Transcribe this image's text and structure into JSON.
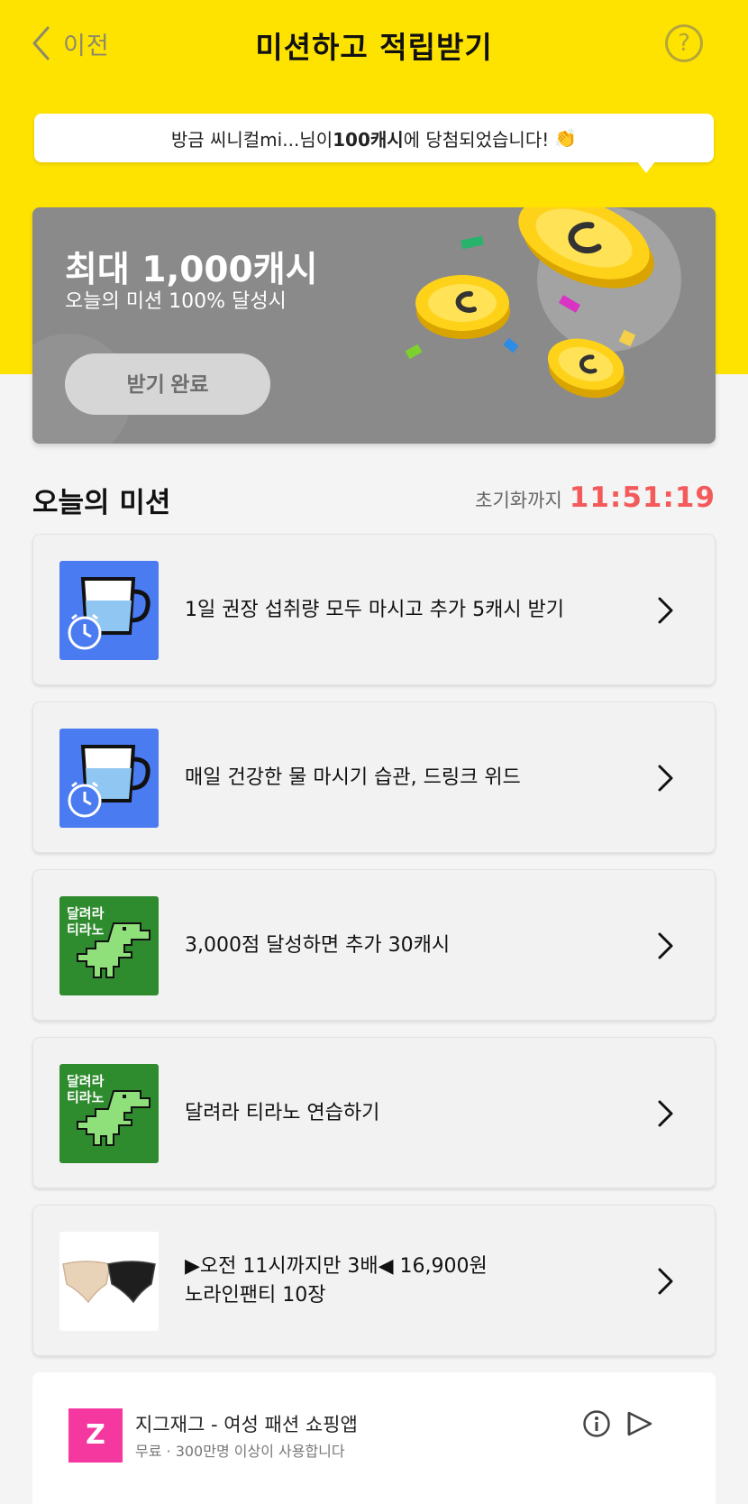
{
  "header": {
    "back_label": "이전",
    "title": "미션하고 적립받기",
    "help_label": "?"
  },
  "notice": {
    "prefix": "방금 씨니컬mi...님이 ",
    "amount": "100캐시",
    "suffix": "에 당첨되었습니다!",
    "emoji": "👏"
  },
  "banner": {
    "title": "최대 1,000캐시",
    "subtitle": "오늘의 미션 100% 달성시",
    "button_label": "받기 완료"
  },
  "missions": {
    "title": "오늘의 미션",
    "reset_label": "초기화까지",
    "reset_time": "11:51:19",
    "items": [
      {
        "line1": "1일 권장 섭취량 모두 마시고 추가 5캐시 받기",
        "line2": "",
        "thumb": "water-cup-icon"
      },
      {
        "line1": "매일 건강한 물 마시기 습관, 드링크 위드",
        "line2": "",
        "thumb": "water-cup-icon"
      },
      {
        "line1": "3,000점 달성하면 추가 30캐시",
        "line2": "",
        "thumb": "dino-game-icon",
        "thumb_text1": "달려라",
        "thumb_text2": "티라노"
      },
      {
        "line1": "달려라 티라노 연습하기",
        "line2": "",
        "thumb": "dino-game-icon",
        "thumb_text1": "달려라",
        "thumb_text2": "티라노"
      },
      {
        "line1": "▶오전 11시까지만 3배◀ 16,900원",
        "line2": "노라인팬티 10장",
        "thumb": "product-image"
      }
    ]
  },
  "ad": {
    "logo_text": "Z",
    "name": "지그재그 - 여성 패션 쇼핑앱",
    "description": "무료 · 300만명 이상이 사용합니다"
  },
  "colors": {
    "header_yellow": "#ffe300",
    "timer_red": "#f45a5a",
    "water_blue": "#4a7bf0",
    "dino_green": "#2e8b2e",
    "ad_pink": "#f538a0"
  }
}
